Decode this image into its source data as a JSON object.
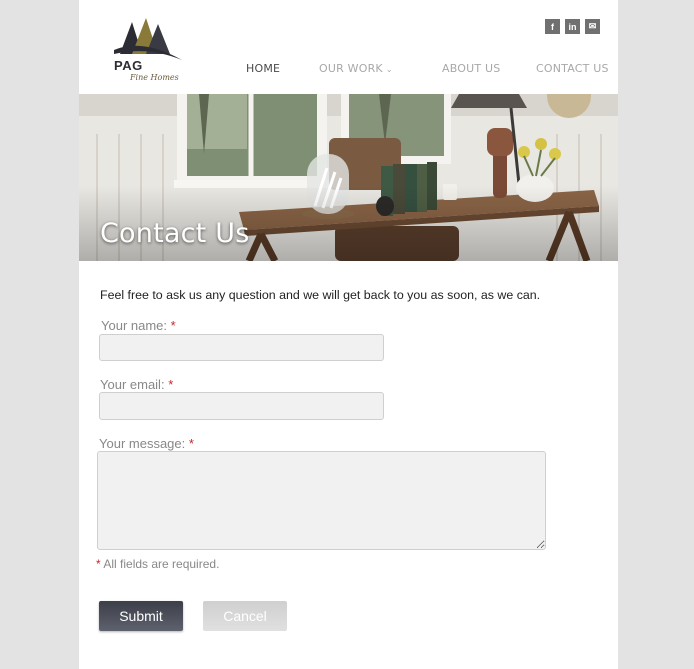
{
  "brand": {
    "name": "PAG",
    "tagline": "Fine Homes"
  },
  "social": [
    {
      "icon": "facebook-icon",
      "glyph": "f"
    },
    {
      "icon": "linkedin-icon",
      "glyph": "in"
    },
    {
      "icon": "mail-icon",
      "glyph": "✉"
    }
  ],
  "nav": {
    "home": "HOME",
    "our_work": "OUR WORK",
    "about_us": "ABOUT US",
    "contact_us": "CONTACT US"
  },
  "hero": {
    "title": "Contact Us"
  },
  "form": {
    "intro": "Feel free to ask us any question and we will get back to you as soon, as we can.",
    "name_label": "Your name:",
    "email_label": "Your email:",
    "message_label": "Your message:",
    "required_mark": "*",
    "name_value": "",
    "email_value": "",
    "message_value": "",
    "required_note": "All fields are required.",
    "submit_label": "Submit",
    "cancel_label": "Cancel"
  },
  "colors": {
    "background": "#e3e3e3",
    "page": "#ffffff",
    "required": "#c0282d",
    "submit": "#464954",
    "nav_active": "#4a4a4a",
    "nav_inactive": "#a8a8a8"
  }
}
